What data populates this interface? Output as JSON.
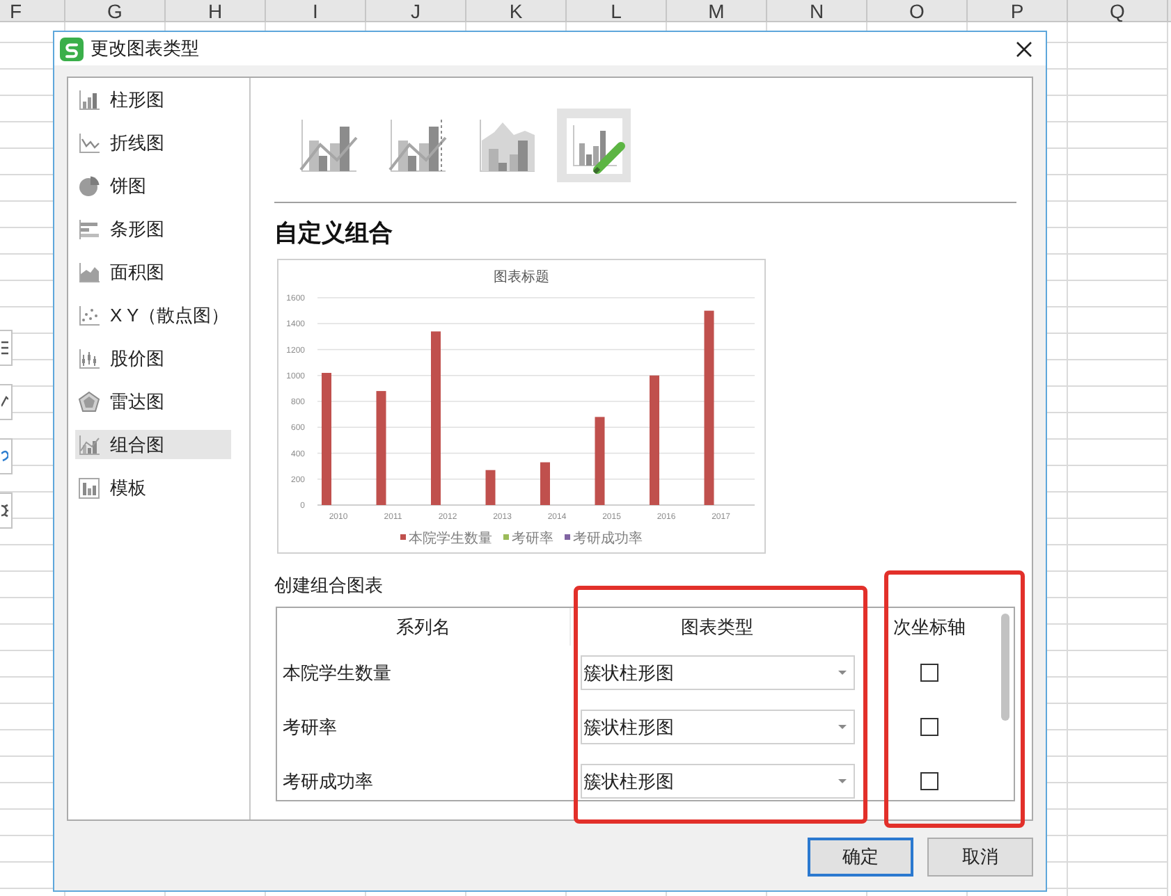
{
  "sheet": {
    "columns": [
      "F",
      "G",
      "H",
      "I",
      "J",
      "K",
      "L",
      "M",
      "N",
      "O",
      "P",
      "Q"
    ]
  },
  "dialog": {
    "title": "更改图表类型"
  },
  "chart_types": [
    {
      "label": "柱形图",
      "kind": "column",
      "selected": false
    },
    {
      "label": "折线图",
      "kind": "line",
      "selected": false
    },
    {
      "label": "饼图",
      "kind": "pie",
      "selected": false
    },
    {
      "label": "条形图",
      "kind": "bar",
      "selected": false
    },
    {
      "label": "面积图",
      "kind": "area",
      "selected": false
    },
    {
      "label": "X Y（散点图）",
      "kind": "scatter",
      "selected": false
    },
    {
      "label": "股价图",
      "kind": "stock",
      "selected": false
    },
    {
      "label": "雷达图",
      "kind": "radar",
      "selected": false
    },
    {
      "label": "组合图",
      "kind": "combo",
      "selected": true
    },
    {
      "label": "模板",
      "kind": "template",
      "selected": false
    }
  ],
  "combo_styles": [
    {
      "kind": "column-line",
      "selected": false
    },
    {
      "kind": "column-line-secondary",
      "selected": false
    },
    {
      "kind": "area-column",
      "selected": false
    },
    {
      "kind": "custom",
      "selected": true
    }
  ],
  "section_title": "自定义组合",
  "preview": {
    "chart_data": {
      "type": "bar",
      "title": "图表标题",
      "categories": [
        "2010",
        "2011",
        "2012",
        "2013",
        "2014",
        "2015",
        "2016",
        "2017"
      ],
      "series": [
        {
          "name": "本院学生数量",
          "color": "#c0504d",
          "values": [
            1020,
            880,
            1340,
            270,
            330,
            680,
            1000,
            1500
          ]
        },
        {
          "name": "考研率",
          "color": "#9bbb59",
          "values": [
            null,
            null,
            null,
            null,
            null,
            null,
            null,
            null
          ]
        },
        {
          "name": "考研成功率",
          "color": "#8064a2",
          "values": [
            null,
            null,
            null,
            null,
            null,
            null,
            null,
            null
          ]
        }
      ],
      "ylim": [
        0,
        1600
      ],
      "yticks": [
        0,
        200,
        400,
        600,
        800,
        1000,
        1200,
        1400,
        1600
      ],
      "grid": true
    }
  },
  "combo": {
    "title": "创建组合图表",
    "columns": [
      "系列名",
      "图表类型",
      "次坐标轴"
    ],
    "rows": [
      {
        "series": "本院学生数量",
        "chart_type": "簇状柱形图",
        "secondary_axis": false
      },
      {
        "series": "考研率",
        "chart_type": "簇状柱形图",
        "secondary_axis": false
      },
      {
        "series": "考研成功率",
        "chart_type": "簇状柱形图",
        "secondary_axis": false
      }
    ]
  },
  "buttons": [
    {
      "label": "确定",
      "default": true
    },
    {
      "label": "取消",
      "default": false
    }
  ]
}
